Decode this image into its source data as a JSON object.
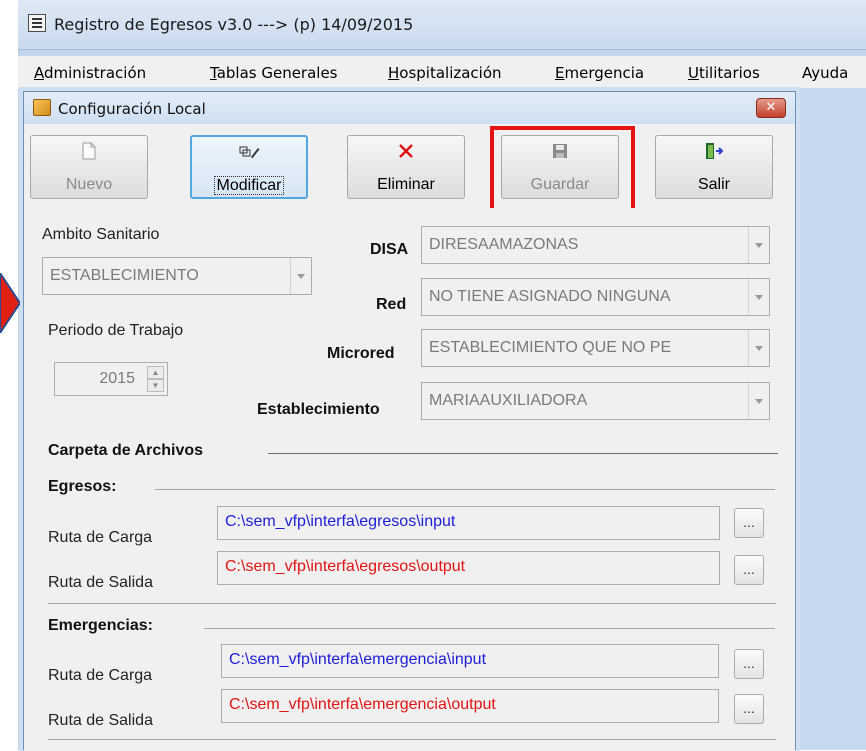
{
  "app": {
    "title": "Registro de Egresos v3.0  ---> (p) 14/09/2015"
  },
  "menu": [
    {
      "u": "A",
      "rest": "dministración"
    },
    {
      "u": "T",
      "rest": "ablas Generales"
    },
    {
      "u": "H",
      "rest": "ospitalización"
    },
    {
      "u": "E",
      "rest": "mergencia"
    },
    {
      "u": "U",
      "rest": "tilitarios"
    },
    {
      "u": "",
      "rest": "Ayuda"
    }
  ],
  "dialog": {
    "title": "Configuración Local",
    "close_label": "✕",
    "toolbar": {
      "nuevo": {
        "label": "Nuevo",
        "icon": "new-document-icon",
        "state": "disabled"
      },
      "modificar": {
        "label": "Modificar",
        "icon": "edit-icon",
        "state": "focused"
      },
      "eliminar": {
        "label": "Eliminar",
        "icon": "delete-x-icon",
        "state": "enabled"
      },
      "guardar": {
        "label": "Guardar",
        "icon": "save-disk-icon",
        "state": "disabled"
      },
      "salir": {
        "label": "Salir",
        "icon": "exit-door-icon",
        "state": "enabled"
      }
    },
    "ambito": {
      "label": "Ambito Sanitario",
      "value": "ESTABLECIMIENTO"
    },
    "periodo": {
      "label": "Periodo de Trabajo",
      "value": "2015"
    },
    "disa": {
      "label": "DISA",
      "value": "DIRESAAMAZONAS"
    },
    "red": {
      "label": "Red",
      "value": "NO TIENE ASIGNADO NINGUNA"
    },
    "microred": {
      "label": "Microred",
      "value": "ESTABLECIMIENTO QUE NO PE"
    },
    "establecimiento": {
      "label": "Establecimiento",
      "value": "MARIAAUXILIADORA"
    },
    "carpeta": {
      "label": "Carpeta de Archivos"
    },
    "egresos": {
      "label": "Egresos:",
      "carga_label": "Ruta de Carga",
      "carga_value": "C:\\sem_vfp\\interfa\\egresos\\input",
      "salida_label": "Ruta de Salida",
      "salida_value": "C:\\sem_vfp\\interfa\\egresos\\output"
    },
    "emergencias": {
      "label": "Emergencias:",
      "carga_label": "Ruta de Carga",
      "carga_value": "C:\\sem_vfp\\interfa\\emergencia\\input",
      "salida_label": "Ruta de Salida",
      "salida_value": "C:\\sem_vfp\\interfa\\emergencia\\output"
    },
    "browse_label": "..."
  },
  "colors": {
    "highlight": "#e41212",
    "input_path": "#1d1dd8",
    "output_path": "#e01414",
    "side_arrow": "#e02010"
  }
}
